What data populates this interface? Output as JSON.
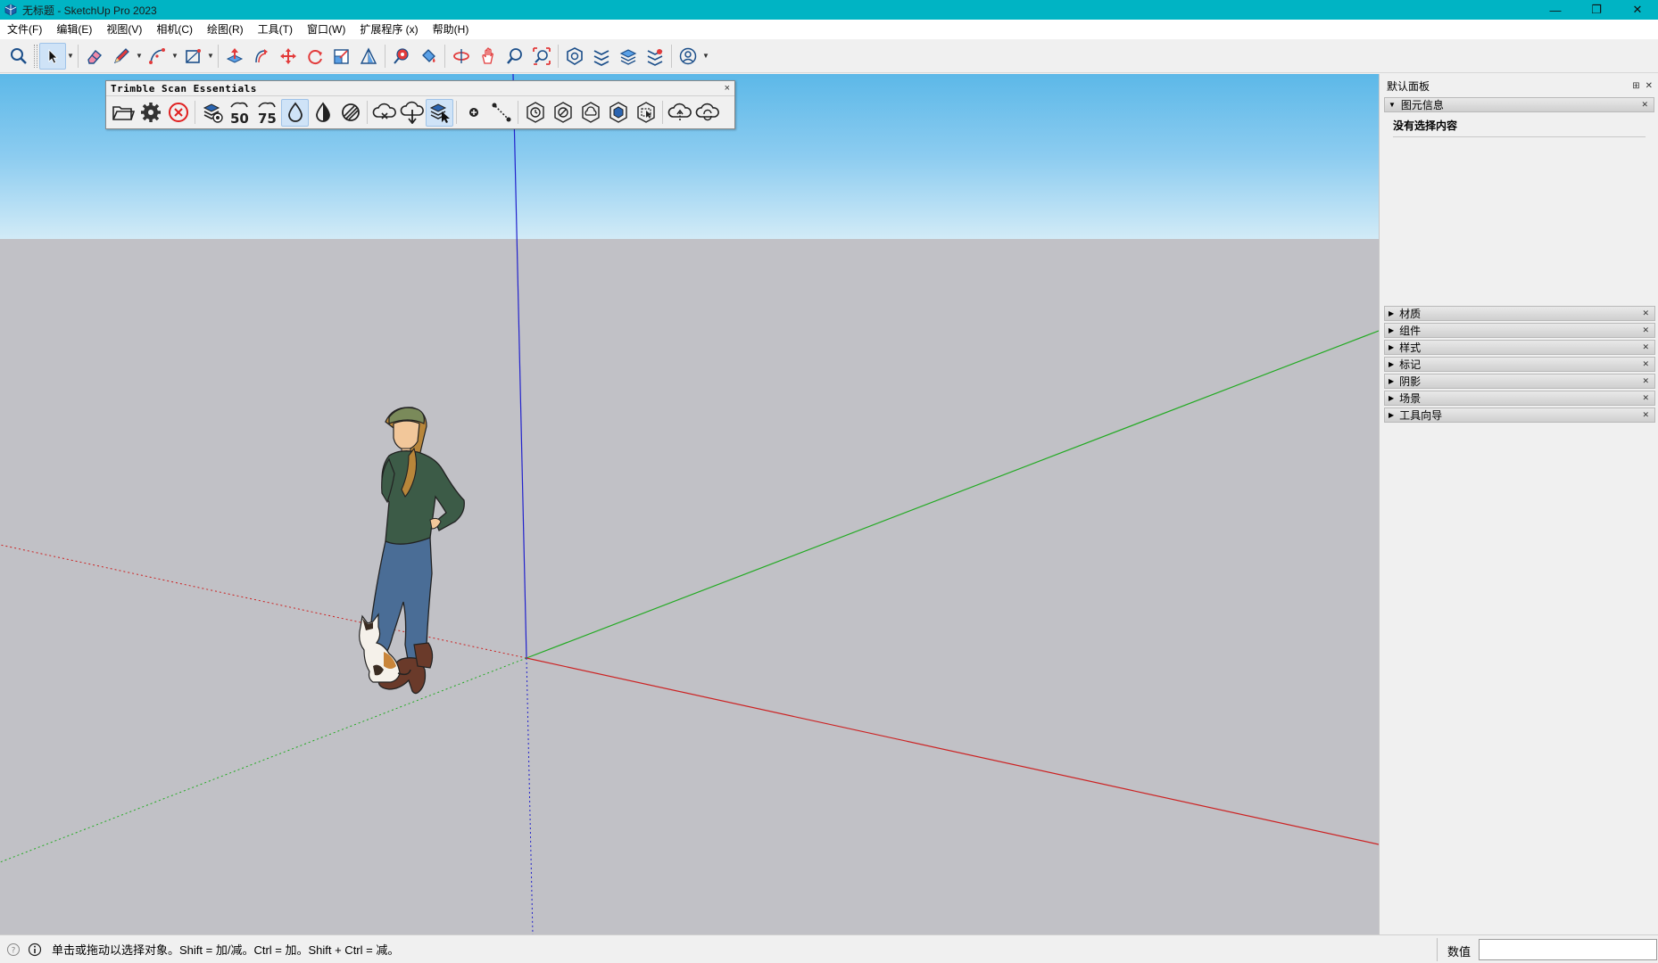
{
  "window": {
    "title": "无标题 - SketchUp Pro 2023",
    "minimize": "—",
    "restore": "❐",
    "close": "✕"
  },
  "menu": [
    "文件(F)",
    "编辑(E)",
    "视图(V)",
    "相机(C)",
    "绘图(R)",
    "工具(T)",
    "窗口(W)",
    "扩展程序 (x)",
    "帮助(H)"
  ],
  "toolbar": {
    "icons": [
      "search-icon",
      "select-icon",
      "eraser-icon",
      "pencil-icon",
      "line-icon",
      "rectangle-icon",
      "push-pull-icon",
      "follow-me-icon",
      "move-icon",
      "rotate-icon",
      "scale-icon",
      "offset-icon",
      "tape-measure-icon",
      "paint-bucket-icon",
      "orbit-icon",
      "pan-icon",
      "zoom-icon",
      "zoom-extents-icon",
      "warehouse-icon",
      "extension-warehouse-icon",
      "layout-icon",
      "extension-manager-icon",
      "account-icon"
    ]
  },
  "trimble": {
    "title": "Trimble Scan Essentials",
    "close": "×",
    "labels": {
      "fifty": "50",
      "seventyfive": "75"
    }
  },
  "panel": {
    "title": "默认面板",
    "pin": "⊞",
    "close": "✕",
    "entity_info": {
      "title": "图元信息",
      "empty_text": "没有选择内容"
    },
    "trays": [
      "材质",
      "组件",
      "样式",
      "标记",
      "阴影",
      "场景",
      "工具向导"
    ]
  },
  "status": {
    "hint": "单击或拖动以选择对象。Shift = 加/减。Ctrl = 加。Shift + Ctrl = 减。",
    "measure_label": "数值",
    "measure_value": ""
  },
  "colors": {
    "titlebar": "#00b4c4",
    "x_axis": "#cc2222",
    "y_axis": "#22aa22",
    "z_axis": "#2222cc",
    "sky": "#8cccf0",
    "ground": "#c1c1c6"
  }
}
